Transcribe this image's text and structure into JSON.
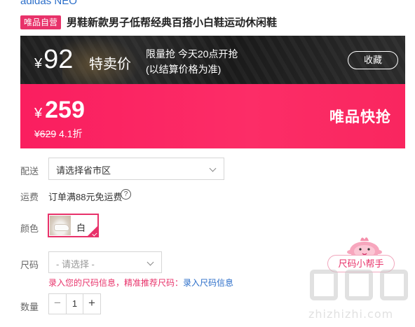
{
  "brand": "adidas NEO",
  "title_row": {
    "badge": "唯品自营",
    "title": "男鞋新款男子低帮经典百搭小白鞋运动休闲鞋"
  },
  "flash_banner": {
    "currency": "¥",
    "price": "92",
    "label": "特卖价",
    "info_line1": "限量抢 今天20点开抢",
    "info_line2": "(以结算价格为准)",
    "favorite_label": "收藏"
  },
  "price_banner": {
    "currency": "¥",
    "price": "259",
    "original_price": "¥629",
    "discount": "4.1折",
    "flash_text": "唯品快抢"
  },
  "delivery": {
    "label": "配送",
    "placeholder": "请选择省市区"
  },
  "shipping": {
    "label": "运费",
    "text": "订单满88元免运费",
    "help_icon": "?"
  },
  "color": {
    "label": "颜色",
    "selected": "白"
  },
  "size": {
    "label": "尺码",
    "placeholder": "- 请选择 -",
    "help_text": "录入您的尺码信息，精准推荐尺码：",
    "help_link": "录入尺码信息"
  },
  "size_helper": {
    "label": "尺码小帮手"
  },
  "quantity": {
    "label": "数量",
    "minus": "−",
    "value": "1",
    "plus": "+"
  },
  "watermark": {
    "text": "zhizhizhi.com"
  },
  "colors": {
    "accent": "#e8326a",
    "link": "#2b6ec9",
    "banner_pink": "#fc2d67",
    "banner_dark": "#222222"
  }
}
